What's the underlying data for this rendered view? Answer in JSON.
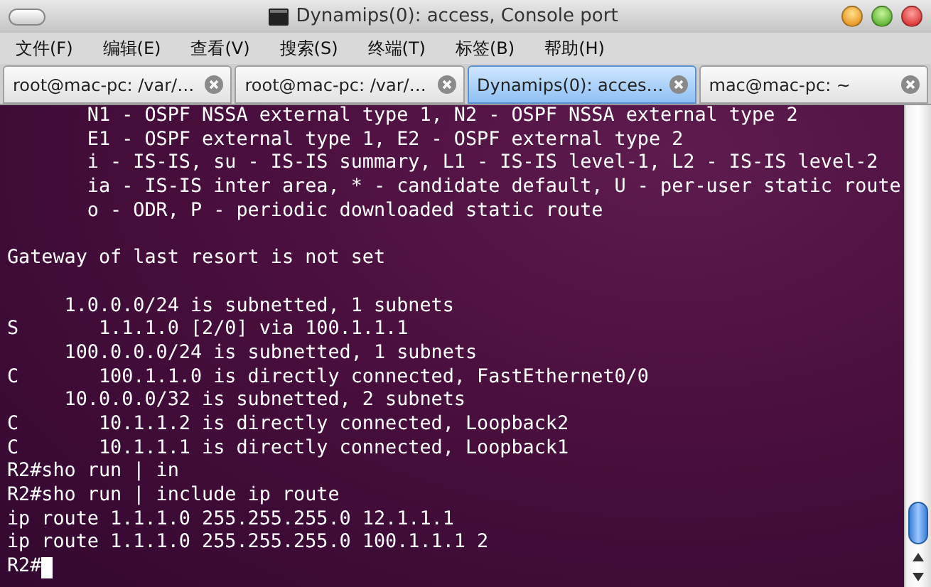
{
  "window": {
    "title": "Dynamips(0): access, Console port"
  },
  "menu": [
    "文件(F)",
    "编辑(E)",
    "查看(V)",
    "搜索(S)",
    "终端(T)",
    "标签(B)",
    "帮助(H)"
  ],
  "tabs": [
    {
      "label": "root@mac-pc: /var/…",
      "selected": false
    },
    {
      "label": "root@mac-pc: /var/…",
      "selected": false
    },
    {
      "label": "Dynamips(0): acces…",
      "selected": true
    },
    {
      "label": "mac@mac-pc: ~",
      "selected": false
    }
  ],
  "terminal": {
    "lines": [
      {
        "kind": "text",
        "text": "       N1 - OSPF NSSA external type 1, N2 - OSPF NSSA external type 2"
      },
      {
        "kind": "text",
        "text": "       E1 - OSPF external type 1, E2 - OSPF external type 2"
      },
      {
        "kind": "text",
        "text": "       i - IS-IS, su - IS-IS summary, L1 - IS-IS level-1, L2 - IS-IS level-2"
      },
      {
        "kind": "text",
        "text": "       ia - IS-IS inter area, * - candidate default, U - per-user static route"
      },
      {
        "kind": "text",
        "text": "       o - ODR, P - periodic downloaded static route"
      },
      {
        "kind": "blank"
      },
      {
        "kind": "text",
        "text": "Gateway of last resort is not set"
      },
      {
        "kind": "blank"
      },
      {
        "kind": "text",
        "text": "     1.0.0.0/24 is subnetted, 1 subnets"
      },
      {
        "kind": "text",
        "text": "S       1.1.1.0 [2/0] via 100.1.1.1"
      },
      {
        "kind": "text",
        "text": "     100.0.0.0/24 is subnetted, 1 subnets"
      },
      {
        "kind": "text",
        "text": "C       100.1.1.0 is directly connected, FastEthernet0/0"
      },
      {
        "kind": "text",
        "text": "     10.0.0.0/32 is subnetted, 2 subnets"
      },
      {
        "kind": "text",
        "text": "C       10.1.1.2 is directly connected, Loopback2"
      },
      {
        "kind": "text",
        "text": "C       10.1.1.1 is directly connected, Loopback1"
      },
      {
        "kind": "text",
        "text": "R2#sho run | in"
      },
      {
        "kind": "text",
        "text": "R2#sho run | include ip route"
      },
      {
        "kind": "text",
        "text": "ip route 1.1.1.0 255.255.255.0 12.1.1.1"
      },
      {
        "kind": "text",
        "text": "ip route 1.1.1.0 255.255.255.0 100.1.1.1 2"
      },
      {
        "kind": "prompt",
        "text": "R2#"
      }
    ]
  }
}
